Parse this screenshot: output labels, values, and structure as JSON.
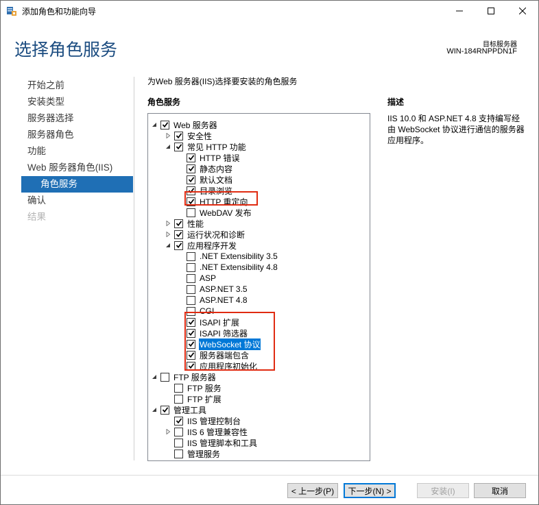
{
  "window": {
    "title": "添加角色和功能向导",
    "icon": "server-manager-icon",
    "controls": [
      "minimize-icon",
      "maximize-icon",
      "close-icon"
    ]
  },
  "header": {
    "title": "选择角色服务",
    "target_label": "目标服务器",
    "target_value": "WIN-184RNPPDN1F"
  },
  "nav": {
    "items": [
      {
        "label": "开始之前",
        "state": "normal"
      },
      {
        "label": "安装类型",
        "state": "normal"
      },
      {
        "label": "服务器选择",
        "state": "normal"
      },
      {
        "label": "服务器角色",
        "state": "normal"
      },
      {
        "label": "功能",
        "state": "normal"
      },
      {
        "label": "Web 服务器角色(IIS)",
        "state": "normal"
      },
      {
        "label": "角色服务",
        "state": "active"
      },
      {
        "label": "确认",
        "state": "normal"
      },
      {
        "label": "结果",
        "state": "disabled"
      }
    ]
  },
  "main": {
    "instruction": "为Web 服务器(IIS)选择要安装的角色服务",
    "roles_heading": "角色服务",
    "desc_heading": "描述",
    "desc_text": "IIS 10.0 和 ASP.NET 4.8 支持编写经由 WebSocket 协议进行通信的服务器应用程序。"
  },
  "tree": [
    {
      "label": "Web 服务器",
      "level": 0,
      "expander": "open",
      "checked": true
    },
    {
      "label": "安全性",
      "level": 1,
      "expander": "closed",
      "checked": true
    },
    {
      "label": "常见 HTTP 功能",
      "level": 1,
      "expander": "open",
      "checked": true
    },
    {
      "label": "HTTP 错误",
      "level": 2,
      "expander": "none",
      "checked": true
    },
    {
      "label": "静态内容",
      "level": 2,
      "expander": "none",
      "checked": true
    },
    {
      "label": "默认文档",
      "level": 2,
      "expander": "none",
      "checked": true
    },
    {
      "label": "目录浏览",
      "level": 2,
      "expander": "none",
      "checked": true
    },
    {
      "label": "HTTP 重定向",
      "level": 2,
      "expander": "none",
      "checked": true
    },
    {
      "label": "WebDAV 发布",
      "level": 2,
      "expander": "none",
      "checked": false
    },
    {
      "label": "性能",
      "level": 1,
      "expander": "closed",
      "checked": true
    },
    {
      "label": "运行状况和诊断",
      "level": 1,
      "expander": "closed",
      "checked": true
    },
    {
      "label": "应用程序开发",
      "level": 1,
      "expander": "open",
      "checked": true
    },
    {
      "label": ".NET Extensibility 3.5",
      "level": 2,
      "expander": "none",
      "checked": false
    },
    {
      "label": ".NET Extensibility 4.8",
      "level": 2,
      "expander": "none",
      "checked": false
    },
    {
      "label": "ASP",
      "level": 2,
      "expander": "none",
      "checked": false
    },
    {
      "label": "ASP.NET 3.5",
      "level": 2,
      "expander": "none",
      "checked": false
    },
    {
      "label": "ASP.NET 4.8",
      "level": 2,
      "expander": "none",
      "checked": false
    },
    {
      "label": "CGI",
      "level": 2,
      "expander": "none",
      "checked": false
    },
    {
      "label": "ISAPI 扩展",
      "level": 2,
      "expander": "none",
      "checked": true
    },
    {
      "label": "ISAPI 筛选器",
      "level": 2,
      "expander": "none",
      "checked": true
    },
    {
      "label": "WebSocket 协议",
      "level": 2,
      "expander": "none",
      "checked": true,
      "selected": true
    },
    {
      "label": "服务器端包含",
      "level": 2,
      "expander": "none",
      "checked": true
    },
    {
      "label": "应用程序初始化",
      "level": 2,
      "expander": "none",
      "checked": true
    },
    {
      "label": "FTP 服务器",
      "level": 0,
      "expander": "open",
      "checked": false
    },
    {
      "label": "FTP 服务",
      "level": 1,
      "expander": "none",
      "checked": false
    },
    {
      "label": "FTP 扩展",
      "level": 1,
      "expander": "none",
      "checked": false
    },
    {
      "label": "管理工具",
      "level": 0,
      "expander": "open",
      "checked": true
    },
    {
      "label": "IIS 管理控制台",
      "level": 1,
      "expander": "none",
      "checked": true
    },
    {
      "label": "IIS 6 管理兼容性",
      "level": 1,
      "expander": "closed",
      "checked": false
    },
    {
      "label": "IIS 管理脚本和工具",
      "level": 1,
      "expander": "none",
      "checked": false
    },
    {
      "label": "管理服务",
      "level": 1,
      "expander": "none",
      "checked": false
    }
  ],
  "buttons": {
    "prev": "< 上一步(P)",
    "next": "下一步(N) >",
    "install": "安装(I)",
    "cancel": "取消"
  }
}
